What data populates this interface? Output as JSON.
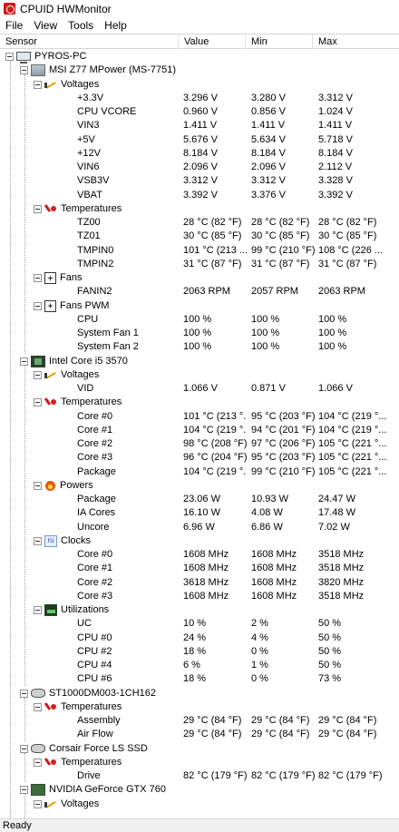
{
  "window": {
    "title": "CPUID HWMonitor"
  },
  "menu": [
    "File",
    "View",
    "Tools",
    "Help"
  ],
  "columns": {
    "sensor": "Sensor",
    "value": "Value",
    "min": "Min",
    "max": "Max"
  },
  "tree": [
    {
      "level": 0,
      "icon": "computer-icon",
      "label": "PYROS-PC"
    },
    {
      "level": 1,
      "icon": "motherboard-icon",
      "label": "MSI Z77 MPower (MS-7751)"
    },
    {
      "level": 2,
      "icon": "voltage-icon",
      "label": "Voltages"
    },
    {
      "level": 3,
      "label": "+3.3V",
      "value": "3.296 V",
      "min": "3.280 V",
      "max": "3.312 V"
    },
    {
      "level": 3,
      "label": "CPU VCORE",
      "value": "0.960 V",
      "min": "0.856 V",
      "max": "1.024 V"
    },
    {
      "level": 3,
      "label": "VIN3",
      "value": "1.411 V",
      "min": "1.411 V",
      "max": "1.411 V"
    },
    {
      "level": 3,
      "label": "+5V",
      "value": "5.676 V",
      "min": "5.634 V",
      "max": "5.718 V"
    },
    {
      "level": 3,
      "label": "+12V",
      "value": "8.184 V",
      "min": "8.184 V",
      "max": "8.184 V"
    },
    {
      "level": 3,
      "label": "VIN6",
      "value": "2.096 V",
      "min": "2.096 V",
      "max": "2.112 V"
    },
    {
      "level": 3,
      "label": "VSB3V",
      "value": "3.312 V",
      "min": "3.312 V",
      "max": "3.328 V"
    },
    {
      "level": 3,
      "label": "VBAT",
      "value": "3.392 V",
      "min": "3.376 V",
      "max": "3.392 V"
    },
    {
      "level": 2,
      "icon": "temperature-icon",
      "label": "Temperatures"
    },
    {
      "level": 3,
      "label": "TZ00",
      "value": "28 °C  (82 °F)",
      "min": "28 °C  (82 °F)",
      "max": "28 °C  (82 °F)"
    },
    {
      "level": 3,
      "label": "TZ01",
      "value": "30 °C  (85 °F)",
      "min": "30 °C  (85 °F)",
      "max": "30 °C  (85 °F)"
    },
    {
      "level": 3,
      "label": "TMPIN0",
      "value": "101 °C  (213 ...",
      "min": "99 °C  (210 °F)",
      "max": "108 °C  (226 ..."
    },
    {
      "level": 3,
      "label": "TMPIN2",
      "value": "31 °C  (87 °F)",
      "min": "31 °C  (87 °F)",
      "max": "31 °C  (87 °F)"
    },
    {
      "level": 2,
      "icon": "fan-icon",
      "label": "Fans"
    },
    {
      "level": 3,
      "label": "FANIN2",
      "value": "2063 RPM",
      "min": "2057 RPM",
      "max": "2063 RPM"
    },
    {
      "level": 2,
      "icon": "fan-pwm-icon",
      "label": "Fans PWM"
    },
    {
      "level": 3,
      "label": "CPU",
      "value": "100 %",
      "min": "100 %",
      "max": "100 %"
    },
    {
      "level": 3,
      "label": "System Fan 1",
      "value": "100 %",
      "min": "100 %",
      "max": "100 %"
    },
    {
      "level": 3,
      "label": "System Fan 2",
      "value": "100 %",
      "min": "100 %",
      "max": "100 %"
    },
    {
      "level": 1,
      "icon": "cpu-icon",
      "label": "Intel Core i5 3570"
    },
    {
      "level": 2,
      "icon": "voltage-icon",
      "label": "Voltages"
    },
    {
      "level": 3,
      "label": "VID",
      "value": "1.066 V",
      "min": "0.871 V",
      "max": "1.066 V"
    },
    {
      "level": 2,
      "icon": "temperature-icon",
      "label": "Temperatures"
    },
    {
      "level": 3,
      "label": "Core #0",
      "value": "101 °C  (213 °...",
      "min": "95 °C  (203 °F)",
      "max": "104 °C  (219 °..."
    },
    {
      "level": 3,
      "label": "Core #1",
      "value": "104 °C  (219 °...",
      "min": "94 °C  (201 °F)",
      "max": "104 °C  (219 °..."
    },
    {
      "level": 3,
      "label": "Core #2",
      "value": "98 °C  (208 °F)",
      "min": "97 °C  (206 °F)",
      "max": "105 °C  (221 °..."
    },
    {
      "level": 3,
      "label": "Core #3",
      "value": "96 °C  (204 °F)",
      "min": "95 °C  (203 °F)",
      "max": "105 °C  (221 °..."
    },
    {
      "level": 3,
      "label": "Package",
      "value": "104 °C  (219 °...",
      "min": "99 °C  (210 °F)",
      "max": "105 °C  (221 °..."
    },
    {
      "level": 2,
      "icon": "power-icon",
      "label": "Powers"
    },
    {
      "level": 3,
      "label": "Package",
      "value": "23.06 W",
      "min": "10.93 W",
      "max": "24.47 W"
    },
    {
      "level": 3,
      "label": "IA Cores",
      "value": "16.10 W",
      "min": "4.08 W",
      "max": "17.48 W"
    },
    {
      "level": 3,
      "label": "Uncore",
      "value": "6.96 W",
      "min": "6.86 W",
      "max": "7.02 W"
    },
    {
      "level": 2,
      "icon": "clock-icon",
      "label": "Clocks"
    },
    {
      "level": 3,
      "label": "Core #0",
      "value": "1608 MHz",
      "min": "1608 MHz",
      "max": "3518 MHz"
    },
    {
      "level": 3,
      "label": "Core #1",
      "value": "1608 MHz",
      "min": "1608 MHz",
      "max": "3518 MHz"
    },
    {
      "level": 3,
      "label": "Core #2",
      "value": "3618 MHz",
      "min": "1608 MHz",
      "max": "3820 MHz"
    },
    {
      "level": 3,
      "label": "Core #3",
      "value": "1608 MHz",
      "min": "1608 MHz",
      "max": "3518 MHz"
    },
    {
      "level": 2,
      "icon": "utilization-icon",
      "label": "Utilizations"
    },
    {
      "level": 3,
      "label": "UC",
      "value": "10 %",
      "min": "2 %",
      "max": "50 %"
    },
    {
      "level": 3,
      "label": "CPU #0",
      "value": "24 %",
      "min": "4 %",
      "max": "50 %"
    },
    {
      "level": 3,
      "label": "CPU #2",
      "value": "18 %",
      "min": "0 %",
      "max": "50 %"
    },
    {
      "level": 3,
      "label": "CPU #4",
      "value": "6 %",
      "min": "1 %",
      "max": "50 %"
    },
    {
      "level": 3,
      "label": "CPU #6",
      "value": "18 %",
      "min": "0 %",
      "max": "73 %"
    },
    {
      "level": 1,
      "icon": "hard-disk-icon",
      "label": "ST1000DM003-1CH162"
    },
    {
      "level": 2,
      "icon": "temperature-icon",
      "label": "Temperatures"
    },
    {
      "level": 3,
      "label": "Assembly",
      "value": "29 °C  (84 °F)",
      "min": "29 °C  (84 °F)",
      "max": "29 °C  (84 °F)"
    },
    {
      "level": 3,
      "label": "Air Flow",
      "value": "29 °C  (84 °F)",
      "min": "29 °C  (84 °F)",
      "max": "29 °C  (84 °F)"
    },
    {
      "level": 1,
      "icon": "ssd-icon",
      "label": "Corsair Force LS SSD"
    },
    {
      "level": 2,
      "icon": "temperature-icon",
      "label": "Temperatures"
    },
    {
      "level": 3,
      "label": "Drive",
      "value": "82 °C  (179 °F)",
      "min": "82 °C  (179 °F)",
      "max": "82 °C  (179 °F)"
    },
    {
      "level": 1,
      "icon": "gpu-icon",
      "label": "NVIDIA GeForce GTX 760"
    },
    {
      "level": 2,
      "icon": "voltage-icon",
      "label": "Voltages"
    }
  ],
  "status": "Ready"
}
